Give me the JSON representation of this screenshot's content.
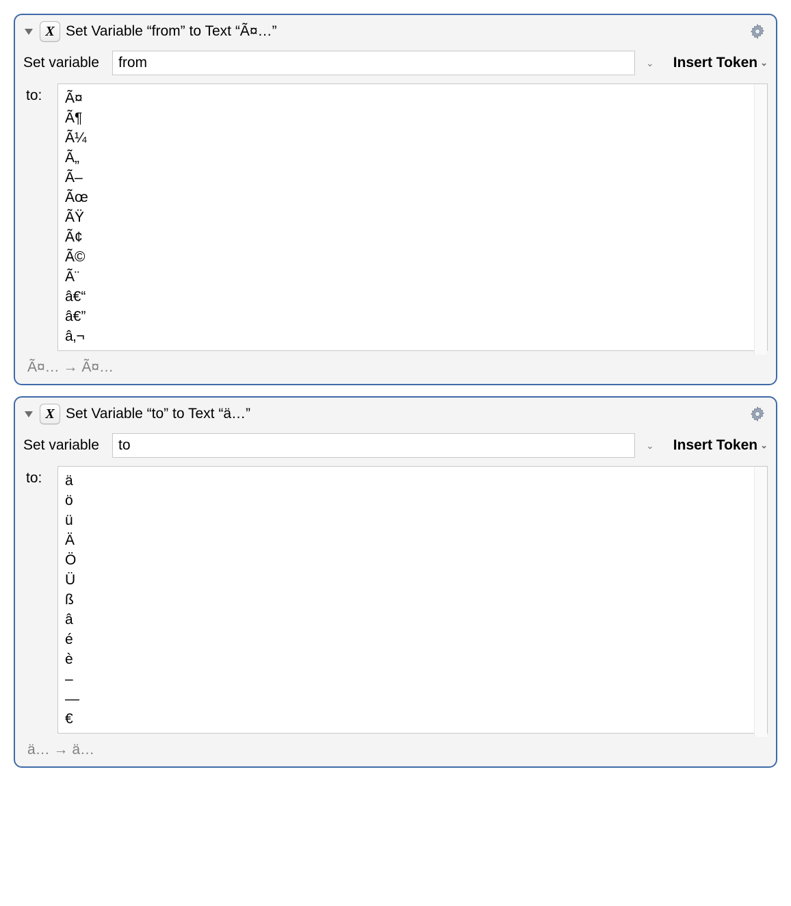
{
  "actions": [
    {
      "icon_glyph": "X",
      "title": "Set Variable “from” to Text “Ã¤…”",
      "set_variable_label": "Set variable",
      "variable_name": "from",
      "insert_token_label": "Insert Token",
      "to_label": "to:",
      "content": "Ã¤\nÃ¶\nÃ¼\nÃ„\nÃ–\nÃœ\nÃŸ\nÃ¢\nÃ©\nÃ¨\nâ€“\nâ€”\nâ‚¬",
      "preview": "Ã¤… → Ã¤…"
    },
    {
      "icon_glyph": "X",
      "title": "Set Variable “to” to Text “ä…”",
      "set_variable_label": "Set variable",
      "variable_name": "to",
      "insert_token_label": "Insert Token",
      "to_label": "to:",
      "content": "ä\nö\nü\nÄ\nÖ\nÜ\nß\nâ\né\nè\n–\n—\n€",
      "preview": "ä… → ä…"
    }
  ]
}
